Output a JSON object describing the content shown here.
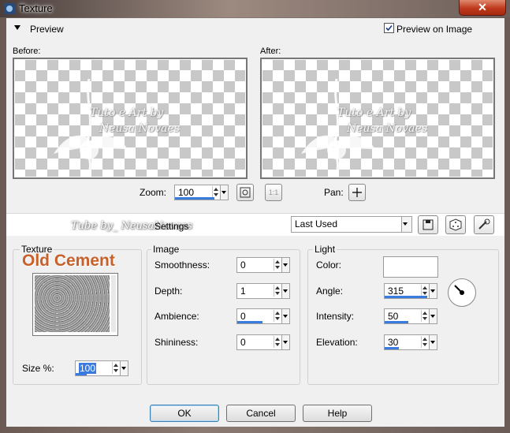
{
  "window": {
    "title": "Texture",
    "close_label": "✕"
  },
  "preview": {
    "header_label": "Preview",
    "preview_on_image_label": "Preview on Image",
    "preview_on_image_checked": true,
    "before_label": "Before:",
    "after_label": "After:",
    "watermark_line1": "Tuto e Art by",
    "watermark_line2": "Neusa Novaes",
    "zoom_label": "Zoom:",
    "zoom_value": "100",
    "one_to_one_label": "1:1",
    "pan_label": "Pan:"
  },
  "settings": {
    "watermark": "Tube by_ NeusaNovaes",
    "label": "Settings",
    "preset_value": "Last Used"
  },
  "texture": {
    "group_label": "Texture",
    "name": "Old Cement",
    "size_label": "Size %:",
    "size_value": "100"
  },
  "image": {
    "group_label": "Image",
    "smoothness_label": "Smoothness:",
    "smoothness_value": "0",
    "depth_label": "Depth:",
    "depth_value": "1",
    "ambience_label": "Ambience:",
    "ambience_value": "0",
    "shininess_label": "Shininess:",
    "shininess_value": "0"
  },
  "light": {
    "group_label": "Light",
    "color_label": "Color:",
    "color_value": "#ffffff",
    "angle_label": "Angle:",
    "angle_value": "315",
    "intensity_label": "Intensity:",
    "intensity_value": "50",
    "elevation_label": "Elevation:",
    "elevation_value": "30"
  },
  "buttons": {
    "ok": "OK",
    "cancel": "Cancel",
    "help": "Help"
  },
  "colors": {
    "accent": "#3a7be0",
    "texture_name": "#c8602a",
    "close": "#c0391c"
  }
}
